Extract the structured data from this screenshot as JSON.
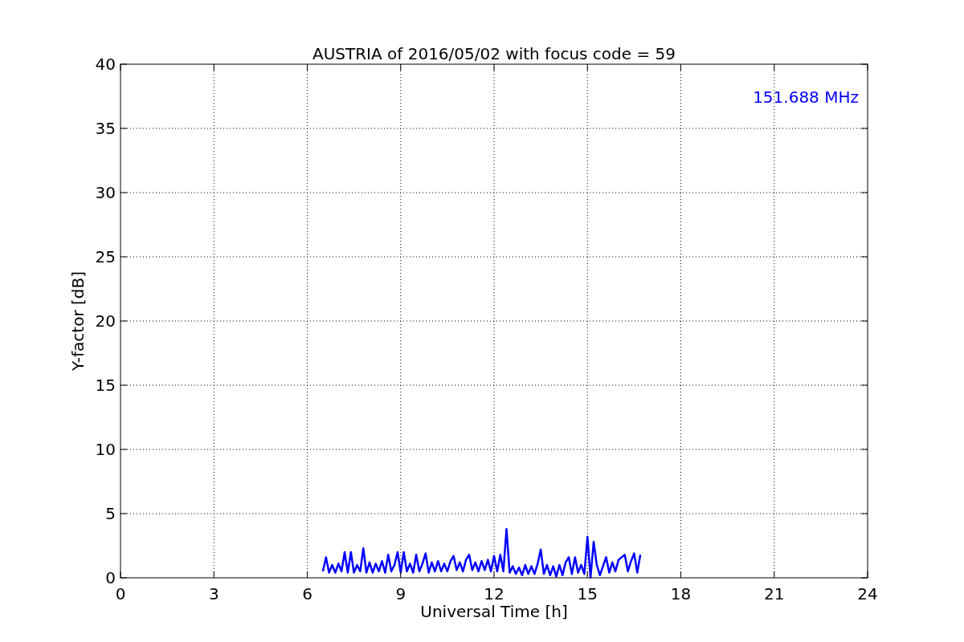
{
  "chart_data": {
    "type": "line",
    "title": "AUSTRIA of 2016/05/02 with focus code = 59",
    "xlabel": "Universal Time [h]",
    "ylabel": "Y-factor [dB]",
    "xlim": [
      0,
      24
    ],
    "ylim": [
      0,
      40
    ],
    "xticks": [
      0,
      3,
      6,
      9,
      12,
      15,
      18,
      21,
      24
    ],
    "yticks": [
      0,
      5,
      10,
      15,
      20,
      25,
      30,
      35,
      40
    ],
    "x": [
      6.5,
      6.6,
      6.7,
      6.8,
      6.9,
      7.0,
      7.1,
      7.2,
      7.3,
      7.4,
      7.5,
      7.6,
      7.7,
      7.8,
      7.9,
      8.0,
      8.1,
      8.2,
      8.3,
      8.4,
      8.5,
      8.6,
      8.7,
      8.8,
      8.9,
      9.0,
      9.1,
      9.2,
      9.3,
      9.4,
      9.5,
      9.6,
      9.7,
      9.8,
      9.9,
      10.0,
      10.1,
      10.2,
      10.3,
      10.4,
      10.5,
      10.6,
      10.7,
      10.8,
      10.9,
      11.0,
      11.1,
      11.2,
      11.3,
      11.4,
      11.5,
      11.6,
      11.7,
      11.8,
      11.9,
      12.0,
      12.1,
      12.2,
      12.3,
      12.4,
      12.5,
      12.6,
      12.7,
      12.8,
      12.9,
      13.0,
      13.1,
      13.2,
      13.3,
      13.4,
      13.5,
      13.6,
      13.7,
      13.8,
      13.9,
      14.0,
      14.1,
      14.2,
      14.3,
      14.4,
      14.5,
      14.6,
      14.7,
      14.8,
      14.9,
      15.0,
      15.1,
      15.2,
      15.3,
      15.4,
      15.5,
      15.6,
      15.7,
      15.8,
      15.9,
      16.0,
      16.1,
      16.2,
      16.3,
      16.4,
      16.5,
      16.6,
      16.7
    ],
    "series": [
      {
        "name": "151.688 MHz",
        "color": "#0000ff",
        "values": [
          0.5,
          1.6,
          0.4,
          1.0,
          0.4,
          1.1,
          0.5,
          2.0,
          0.4,
          2.0,
          0.4,
          1.0,
          0.5,
          2.3,
          0.4,
          1.2,
          0.4,
          1.1,
          0.5,
          1.3,
          0.4,
          1.8,
          0.5,
          1.0,
          2.0,
          0.4,
          2.0,
          0.5,
          1.1,
          0.4,
          1.8,
          0.5,
          1.1,
          1.9,
          0.4,
          1.2,
          0.5,
          1.3,
          0.5,
          1.1,
          0.5,
          1.3,
          1.7,
          0.6,
          1.2,
          0.5,
          1.4,
          1.8,
          0.6,
          1.2,
          0.5,
          1.3,
          0.6,
          1.4,
          0.5,
          1.7,
          0.5,
          1.8,
          0.5,
          3.8,
          0.4,
          0.9,
          0.3,
          0.8,
          0.2,
          1.0,
          0.3,
          0.9,
          0.3,
          1.1,
          2.2,
          0.3,
          1.0,
          0.2,
          0.9,
          0.1,
          1.0,
          0.2,
          1.2,
          1.6,
          0.3,
          1.6,
          0.4,
          1.0,
          0.3,
          3.2,
          0.0,
          2.8,
          1.0,
          0.2,
          0.9,
          1.6,
          0.4,
          1.2,
          0.5,
          1.4,
          1.6,
          1.8,
          0.5,
          1.3,
          1.9,
          0.4,
          1.8
        ]
      }
    ],
    "grid": true
  }
}
